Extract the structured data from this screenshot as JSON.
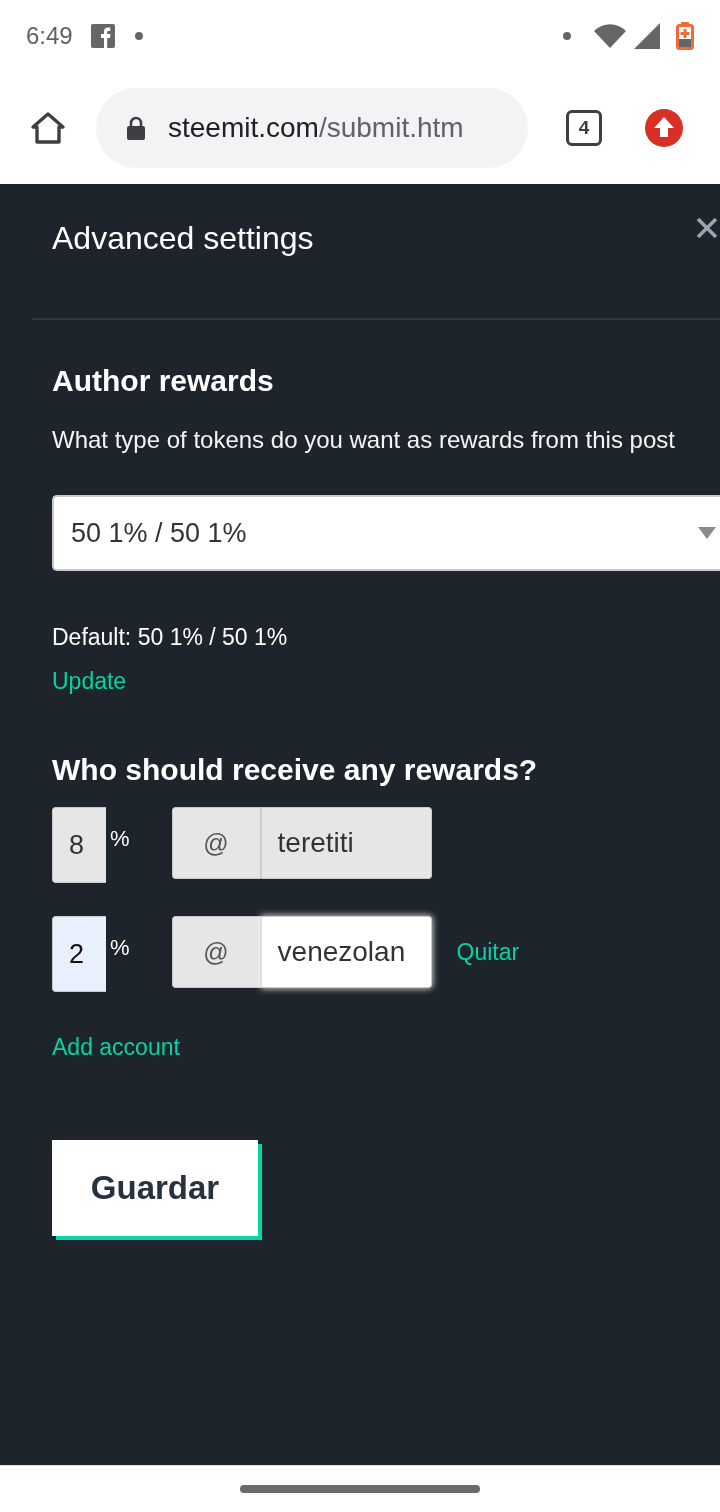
{
  "status_bar": {
    "time": "6:49"
  },
  "browser": {
    "url_host": "steemit.com",
    "url_path": "/submit.htm",
    "tab_count": "4"
  },
  "dialog": {
    "title": "Advanced settings"
  },
  "author_rewards": {
    "heading": "Author rewards",
    "description": "What type of tokens do you want as rewards from this post",
    "select_value": "50 1% / 50 1%",
    "default_text": "Default: 50 1% / 50 1%",
    "update_link": "Update"
  },
  "beneficiaries": {
    "heading": "Who should receive any rewards?",
    "rows": [
      {
        "percent": "8",
        "percent_sign": "%",
        "at_sign": "@",
        "username": "teretiti",
        "disabled": true,
        "focused": false
      },
      {
        "percent": "2",
        "percent_sign": "%",
        "at_sign": "@",
        "username": "venezolan",
        "disabled": false,
        "focused": true,
        "remove_link": "Quitar"
      }
    ],
    "add_link": "Add account"
  },
  "save_button": "Guardar"
}
